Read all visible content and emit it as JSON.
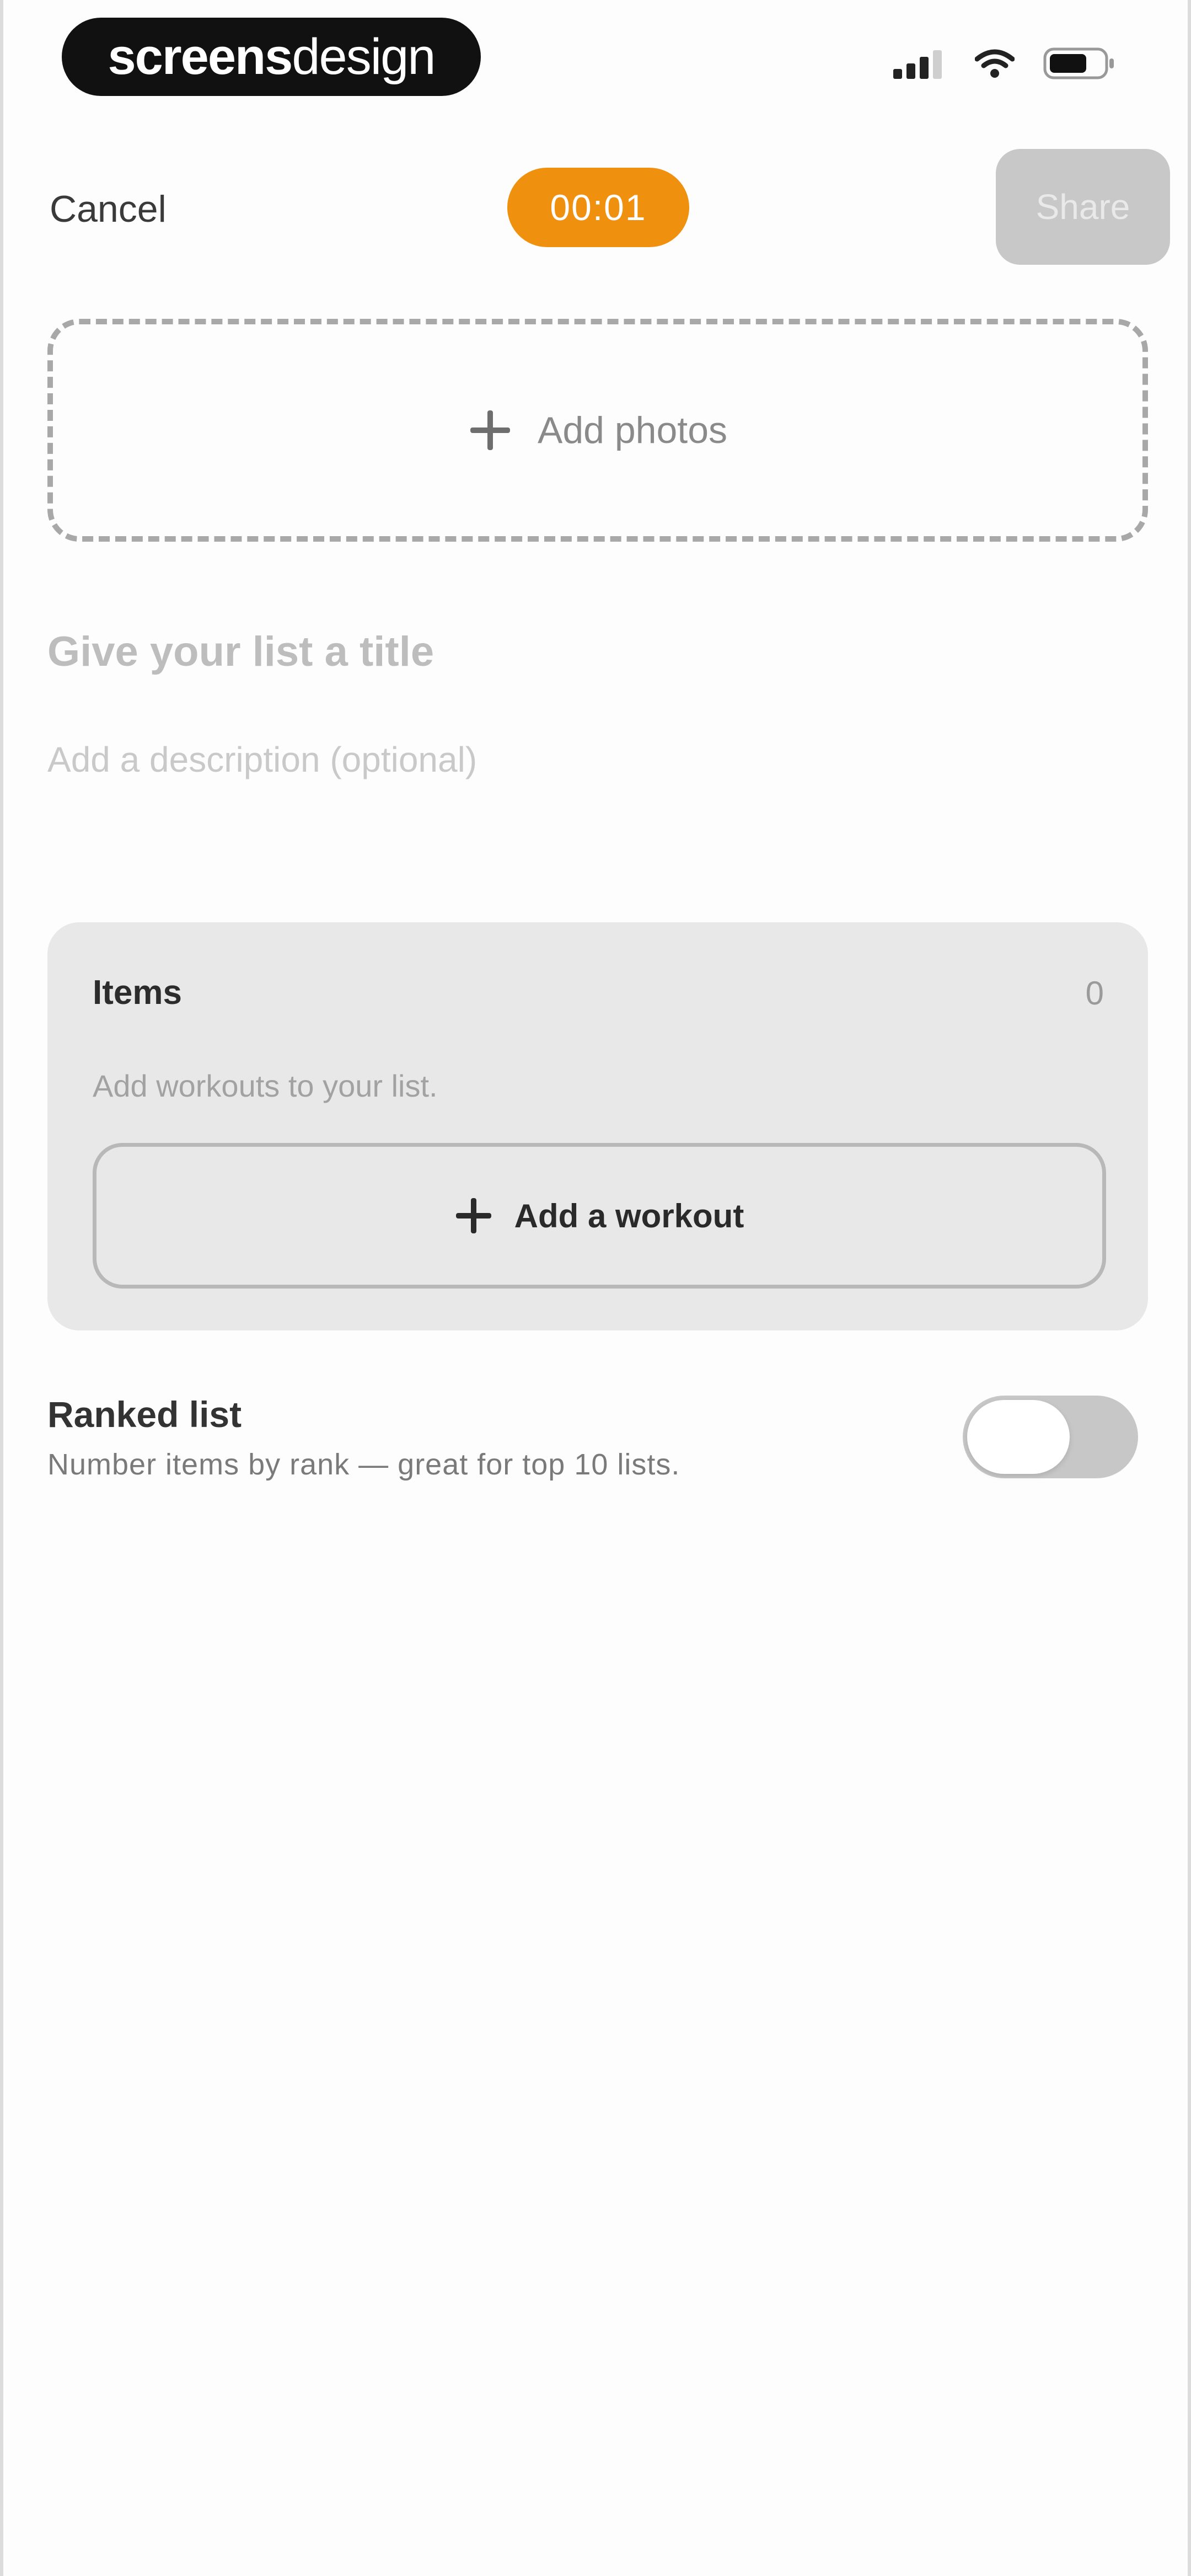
{
  "status_bar": {
    "brand_bold": "screens",
    "brand_light": "design"
  },
  "nav": {
    "cancel_label": "Cancel",
    "timer": "00:01",
    "share_label": "Share"
  },
  "photos": {
    "label": "Add photos",
    "icon": "plus-icon"
  },
  "form": {
    "title_placeholder": "Give your list a title",
    "description_placeholder": "Add a description (optional)"
  },
  "items": {
    "title": "Items",
    "count": "0",
    "hint": "Add workouts to your list.",
    "add_label": "Add a workout",
    "add_icon": "plus-icon"
  },
  "ranked": {
    "title": "Ranked list",
    "subtitle": "Number items by rank — great for top 10 lists.",
    "enabled": false
  },
  "colors": {
    "accent": "#f0900f",
    "share_disabled": "#c8c8c8",
    "card_bg": "#e8e8e8"
  }
}
